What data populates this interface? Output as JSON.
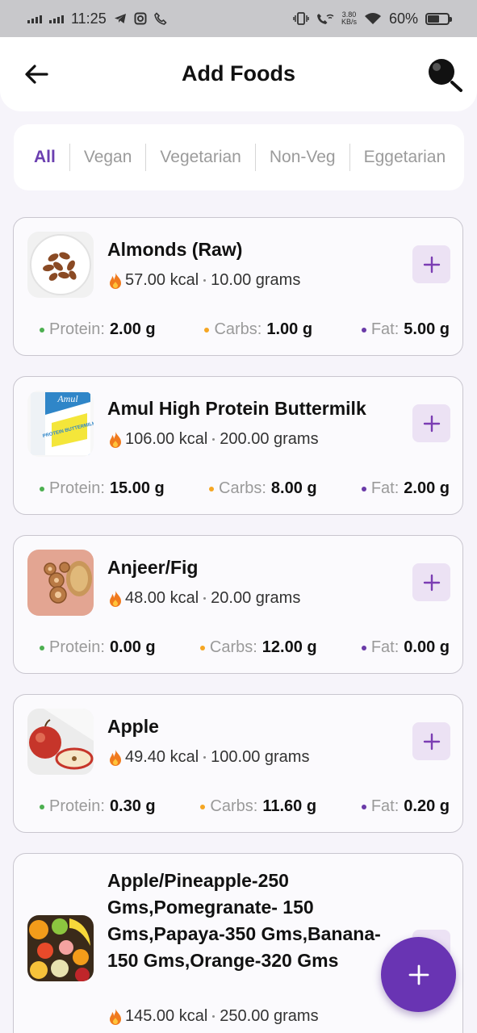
{
  "status_bar": {
    "time": "11:25",
    "speed_value": "3.80",
    "speed_unit": "KB/s",
    "battery": "60%"
  },
  "header": {
    "title": "Add Foods",
    "back_icon": "arrow-left-icon",
    "search_icon": "search-icon"
  },
  "filters": [
    {
      "label": "All",
      "active": true
    },
    {
      "label": "Vegan",
      "active": false
    },
    {
      "label": "Vegetarian",
      "active": false
    },
    {
      "label": "Non-Veg",
      "active": false
    },
    {
      "label": "Eggetarian",
      "active": false
    }
  ],
  "macro_labels": {
    "protein": "Protein:",
    "carbs": "Carbs:",
    "fat": "Fat:"
  },
  "colors": {
    "accent": "#6b3fb0",
    "protein_dot": "#4caf50",
    "carbs_dot": "#f5a623",
    "fat_dot": "#6a3aa8",
    "add_button_bg": "#ece2f4",
    "fab": "#6934b3"
  },
  "foods": [
    {
      "name": "Almonds (Raw)",
      "kcal": "57.00 kcal",
      "quantity": "10.00 grams",
      "protein": "2.00 g",
      "carbs": "1.00 g",
      "fat": "5.00 g",
      "image": "almonds-bowl-image"
    },
    {
      "name": "Amul High Protein Buttermilk",
      "kcal": "106.00 kcal",
      "quantity": "200.00 grams",
      "protein": "15.00 g",
      "carbs": "8.00 g",
      "fat": "2.00 g",
      "image": "buttermilk-pack-image",
      "image_text": "Amul",
      "image_text_2": "PROTEIN BUTTERMILK"
    },
    {
      "name": "Anjeer/Fig",
      "kcal": "48.00 kcal",
      "quantity": "20.00 grams",
      "protein": "0.00 g",
      "carbs": "12.00 g",
      "fat": "0.00 g",
      "image": "dried-fig-image"
    },
    {
      "name": "Apple",
      "kcal": "49.40 kcal",
      "quantity": "100.00 grams",
      "protein": "0.30 g",
      "carbs": "11.60 g",
      "fat": "0.20 g",
      "image": "apple-image"
    },
    {
      "name": "Apple/Pineapple-250 Gms,Pomegranate- 150 Gms,Papaya-350 Gms,Banana-150 Gms,Orange-320 Gms",
      "kcal": "145.00 kcal",
      "quantity": "250.00 grams",
      "image": "fruit-mix-image"
    }
  ],
  "fab_icon": "plus-icon"
}
